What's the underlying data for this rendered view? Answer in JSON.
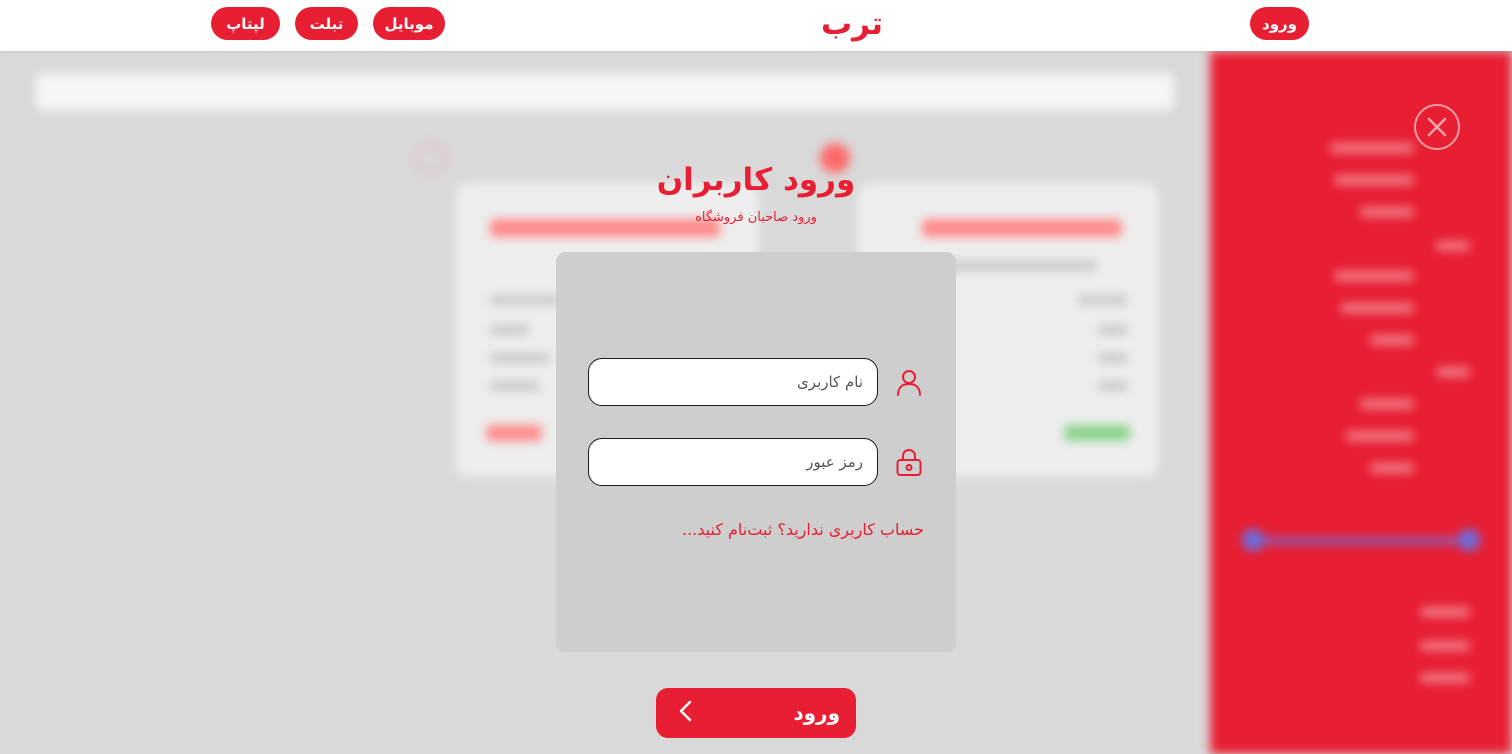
{
  "header": {
    "login_label": "ورود",
    "brand": "ترب",
    "category_buttons": [
      "موبایل",
      "تبلت",
      "لپتاپ"
    ]
  },
  "login": {
    "title": "ورود کاربران",
    "subtitle": "ورود صاحبان فروشگاه",
    "username_placeholder": "نام کاربری",
    "password_placeholder": "رمز عبور",
    "register_link": "حساب کاربری ندارید؟ ثبت‌نام کنید...",
    "submit_label": "ورود"
  },
  "colors": {
    "accent": "#e81e32",
    "overlay": "#d9d9d9",
    "panel": "#cecece",
    "header_bg": "#ffffff"
  },
  "icons": {
    "username": "user-icon",
    "password": "lock-icon",
    "submit": "chevron-left-icon",
    "sidebar_close": "close-icon"
  }
}
